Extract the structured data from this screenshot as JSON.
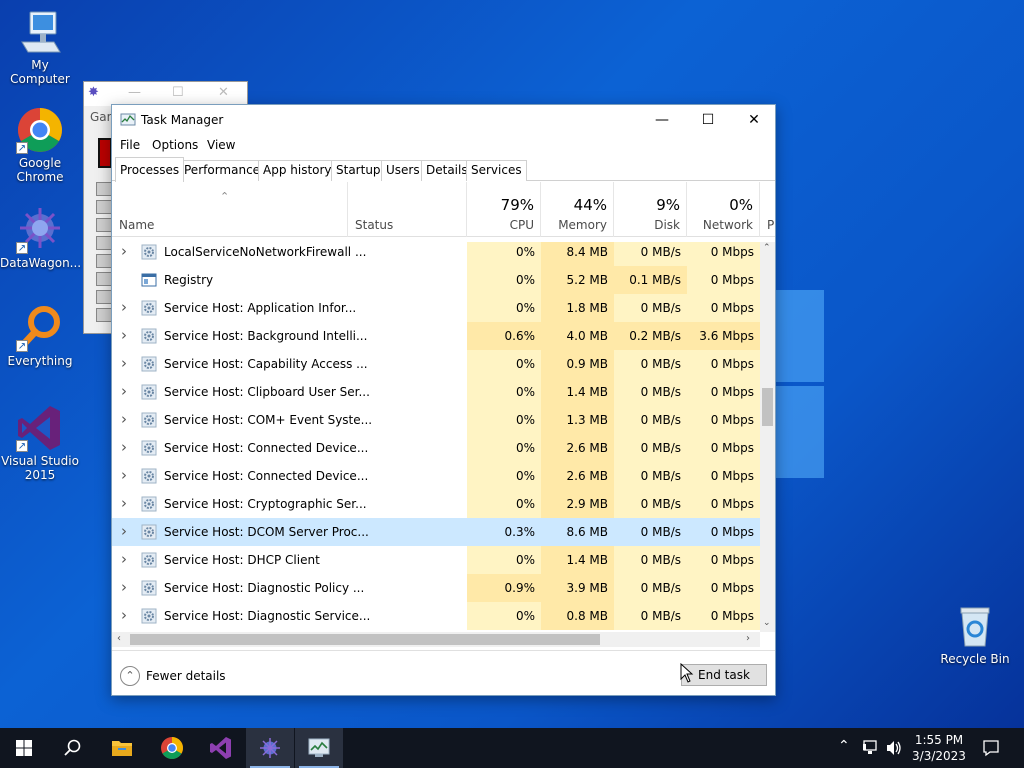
{
  "desktop": {
    "icons": [
      {
        "label": "My Computer",
        "icon": "computer-icon"
      },
      {
        "label": "Google Chrome",
        "icon": "chrome-icon"
      },
      {
        "label": "DataWagon...",
        "icon": "datawagon-icon"
      },
      {
        "label": "Everything",
        "icon": "everything-search-icon"
      },
      {
        "label": "Visual Studio 2015",
        "icon": "visual-studio-icon"
      },
      {
        "label": "Recycle Bin",
        "icon": "recycle-bin-icon"
      }
    ],
    "back_window": {
      "partial_label": "Gam"
    }
  },
  "task_manager": {
    "title": "Task Manager",
    "menu": [
      "File",
      "Options",
      "View"
    ],
    "tabs": [
      "Processes",
      "Performance",
      "App history",
      "Startup",
      "Users",
      "Details",
      "Services"
    ],
    "active_tab": "Processes",
    "columns": {
      "name": "Name",
      "status": "Status",
      "cpu": {
        "pct": "79%",
        "label": "CPU"
      },
      "memory": {
        "pct": "44%",
        "label": "Memory"
      },
      "disk": {
        "pct": "9%",
        "label": "Disk"
      },
      "network": {
        "pct": "0%",
        "label": "Network"
      },
      "power_partial": "P"
    },
    "processes": [
      {
        "name": "LocalServiceNoNetworkFirewall ...",
        "cpu": "0%",
        "memory": "8.4 MB",
        "disk": "0 MB/s",
        "network": "0 Mbps",
        "expandable": true,
        "icon": "gear-icon"
      },
      {
        "name": "Registry",
        "cpu": "0%",
        "memory": "5.2 MB",
        "disk": "0.1 MB/s",
        "network": "0 Mbps",
        "expandable": false,
        "icon": "registry-icon"
      },
      {
        "name": "Service Host: Application Infor...",
        "cpu": "0%",
        "memory": "1.8 MB",
        "disk": "0 MB/s",
        "network": "0 Mbps",
        "expandable": true,
        "icon": "gear-icon"
      },
      {
        "name": "Service Host: Background Intelli...",
        "cpu": "0.6%",
        "memory": "4.0 MB",
        "disk": "0.2 MB/s",
        "network": "3.6 Mbps",
        "expandable": true,
        "icon": "gear-icon"
      },
      {
        "name": "Service Host: Capability Access ...",
        "cpu": "0%",
        "memory": "0.9 MB",
        "disk": "0 MB/s",
        "network": "0 Mbps",
        "expandable": true,
        "icon": "gear-icon"
      },
      {
        "name": "Service Host: Clipboard User Ser...",
        "cpu": "0%",
        "memory": "1.4 MB",
        "disk": "0 MB/s",
        "network": "0 Mbps",
        "expandable": true,
        "icon": "gear-icon"
      },
      {
        "name": "Service Host: COM+ Event Syste...",
        "cpu": "0%",
        "memory": "1.3 MB",
        "disk": "0 MB/s",
        "network": "0 Mbps",
        "expandable": true,
        "icon": "gear-icon"
      },
      {
        "name": "Service Host: Connected Device...",
        "cpu": "0%",
        "memory": "2.6 MB",
        "disk": "0 MB/s",
        "network": "0 Mbps",
        "expandable": true,
        "icon": "gear-icon"
      },
      {
        "name": "Service Host: Connected Device...",
        "cpu": "0%",
        "memory": "2.6 MB",
        "disk": "0 MB/s",
        "network": "0 Mbps",
        "expandable": true,
        "icon": "gear-icon"
      },
      {
        "name": "Service Host: Cryptographic Ser...",
        "cpu": "0%",
        "memory": "2.9 MB",
        "disk": "0 MB/s",
        "network": "0 Mbps",
        "expandable": true,
        "icon": "gear-icon"
      },
      {
        "name": "Service Host: DCOM Server Proc...",
        "cpu": "0.3%",
        "memory": "8.6 MB",
        "disk": "0 MB/s",
        "network": "0 Mbps",
        "expandable": true,
        "icon": "gear-icon",
        "selected": true
      },
      {
        "name": "Service Host: DHCP Client",
        "cpu": "0%",
        "memory": "1.4 MB",
        "disk": "0 MB/s",
        "network": "0 Mbps",
        "expandable": true,
        "icon": "gear-icon"
      },
      {
        "name": "Service Host: Diagnostic Policy ...",
        "cpu": "0.9%",
        "memory": "3.9 MB",
        "disk": "0 MB/s",
        "network": "0 Mbps",
        "expandable": true,
        "icon": "gear-icon"
      },
      {
        "name": "Service Host: Diagnostic Service...",
        "cpu": "0%",
        "memory": "0.8 MB",
        "disk": "0 MB/s",
        "network": "0 Mbps",
        "expandable": true,
        "icon": "gear-icon"
      }
    ],
    "footer": {
      "fewer_details": "Fewer details",
      "end_task": "End task"
    }
  },
  "taskbar": {
    "items": [
      "start-icon",
      "search-icon",
      "file-explorer-icon",
      "chrome-icon",
      "visual-studio-icon",
      "datawagon-icon",
      "task-manager-icon"
    ],
    "clock": {
      "time": "1:55 PM",
      "date": "3/3/2023"
    }
  },
  "colors": {
    "accent": "#0078d7",
    "heat_low": "#fff4c4",
    "heat_mid": "#ffe9a8",
    "selected_row": "#cce8ff",
    "taskbar": "#10151f"
  }
}
